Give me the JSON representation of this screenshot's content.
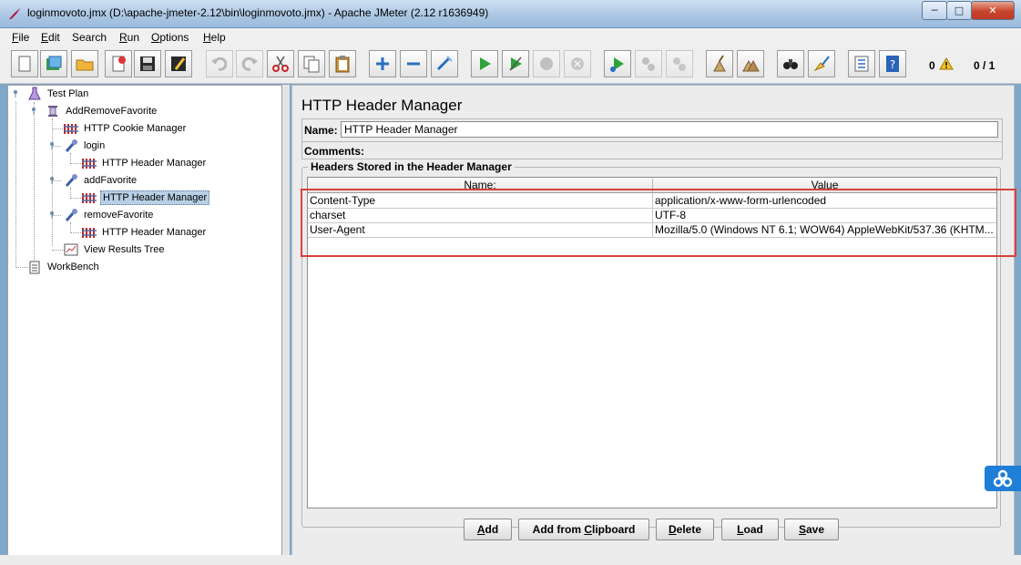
{
  "window": {
    "title": "loginmovoto.jmx (D:\\apache-jmeter-2.12\\bin\\loginmovoto.jmx) - Apache JMeter (2.12 r1636949)",
    "minimize": "─",
    "maximize": "□",
    "close": "✕"
  },
  "menu": {
    "file": {
      "u": "F",
      "rest": "ile"
    },
    "edit": {
      "u": "E",
      "rest": "dit"
    },
    "search": {
      "u": "",
      "rest": "Search"
    },
    "run": {
      "u": "R",
      "rest": "un"
    },
    "options": {
      "u": "O",
      "rest": "ptions"
    },
    "help": {
      "u": "H",
      "rest": "elp"
    }
  },
  "toolbar": {
    "error_count": "0",
    "threads": "0 / 1"
  },
  "tree": {
    "nodes": [
      {
        "label": "Test Plan"
      },
      {
        "label": "AddRemoveFavorite"
      },
      {
        "label": "HTTP Cookie Manager"
      },
      {
        "label": "login"
      },
      {
        "label": "HTTP Header Manager"
      },
      {
        "label": "addFavorite"
      },
      {
        "label": "HTTP Header Manager"
      },
      {
        "label": "removeFavorite"
      },
      {
        "label": "HTTP Header Manager"
      },
      {
        "label": "View Results Tree"
      },
      {
        "label": "WorkBench"
      }
    ]
  },
  "panel": {
    "title": "HTTP Header Manager",
    "name_label": "Name:",
    "name_value": "HTTP Header Manager",
    "comments_label": "Comments:",
    "group_title": "Headers Stored in the Header Manager",
    "columns": {
      "name": "Name:",
      "value": "Value"
    },
    "rows": [
      {
        "name": "Content-Type",
        "value": "application/x-www-form-urlencoded"
      },
      {
        "name": "charset",
        "value": "UTF-8"
      },
      {
        "name": "User-Agent",
        "value": "Mozilla/5.0 (Windows NT 6.1; WOW64) AppleWebKit/537.36 (KHTM..."
      }
    ],
    "buttons": {
      "add": {
        "u": "A",
        "rest": "dd"
      },
      "add_clipboard": {
        "pre": "Add from ",
        "u": "C",
        "rest": "lipboard"
      },
      "delete": {
        "u": "D",
        "rest": "elete"
      },
      "load": {
        "u": "L",
        "rest": "oad"
      },
      "save": {
        "u": "S",
        "rest": "ave"
      }
    }
  },
  "colors": {
    "highlight": "#d9413c",
    "selection": "#b8cfe5",
    "side_widget": "#1f7ed6"
  }
}
